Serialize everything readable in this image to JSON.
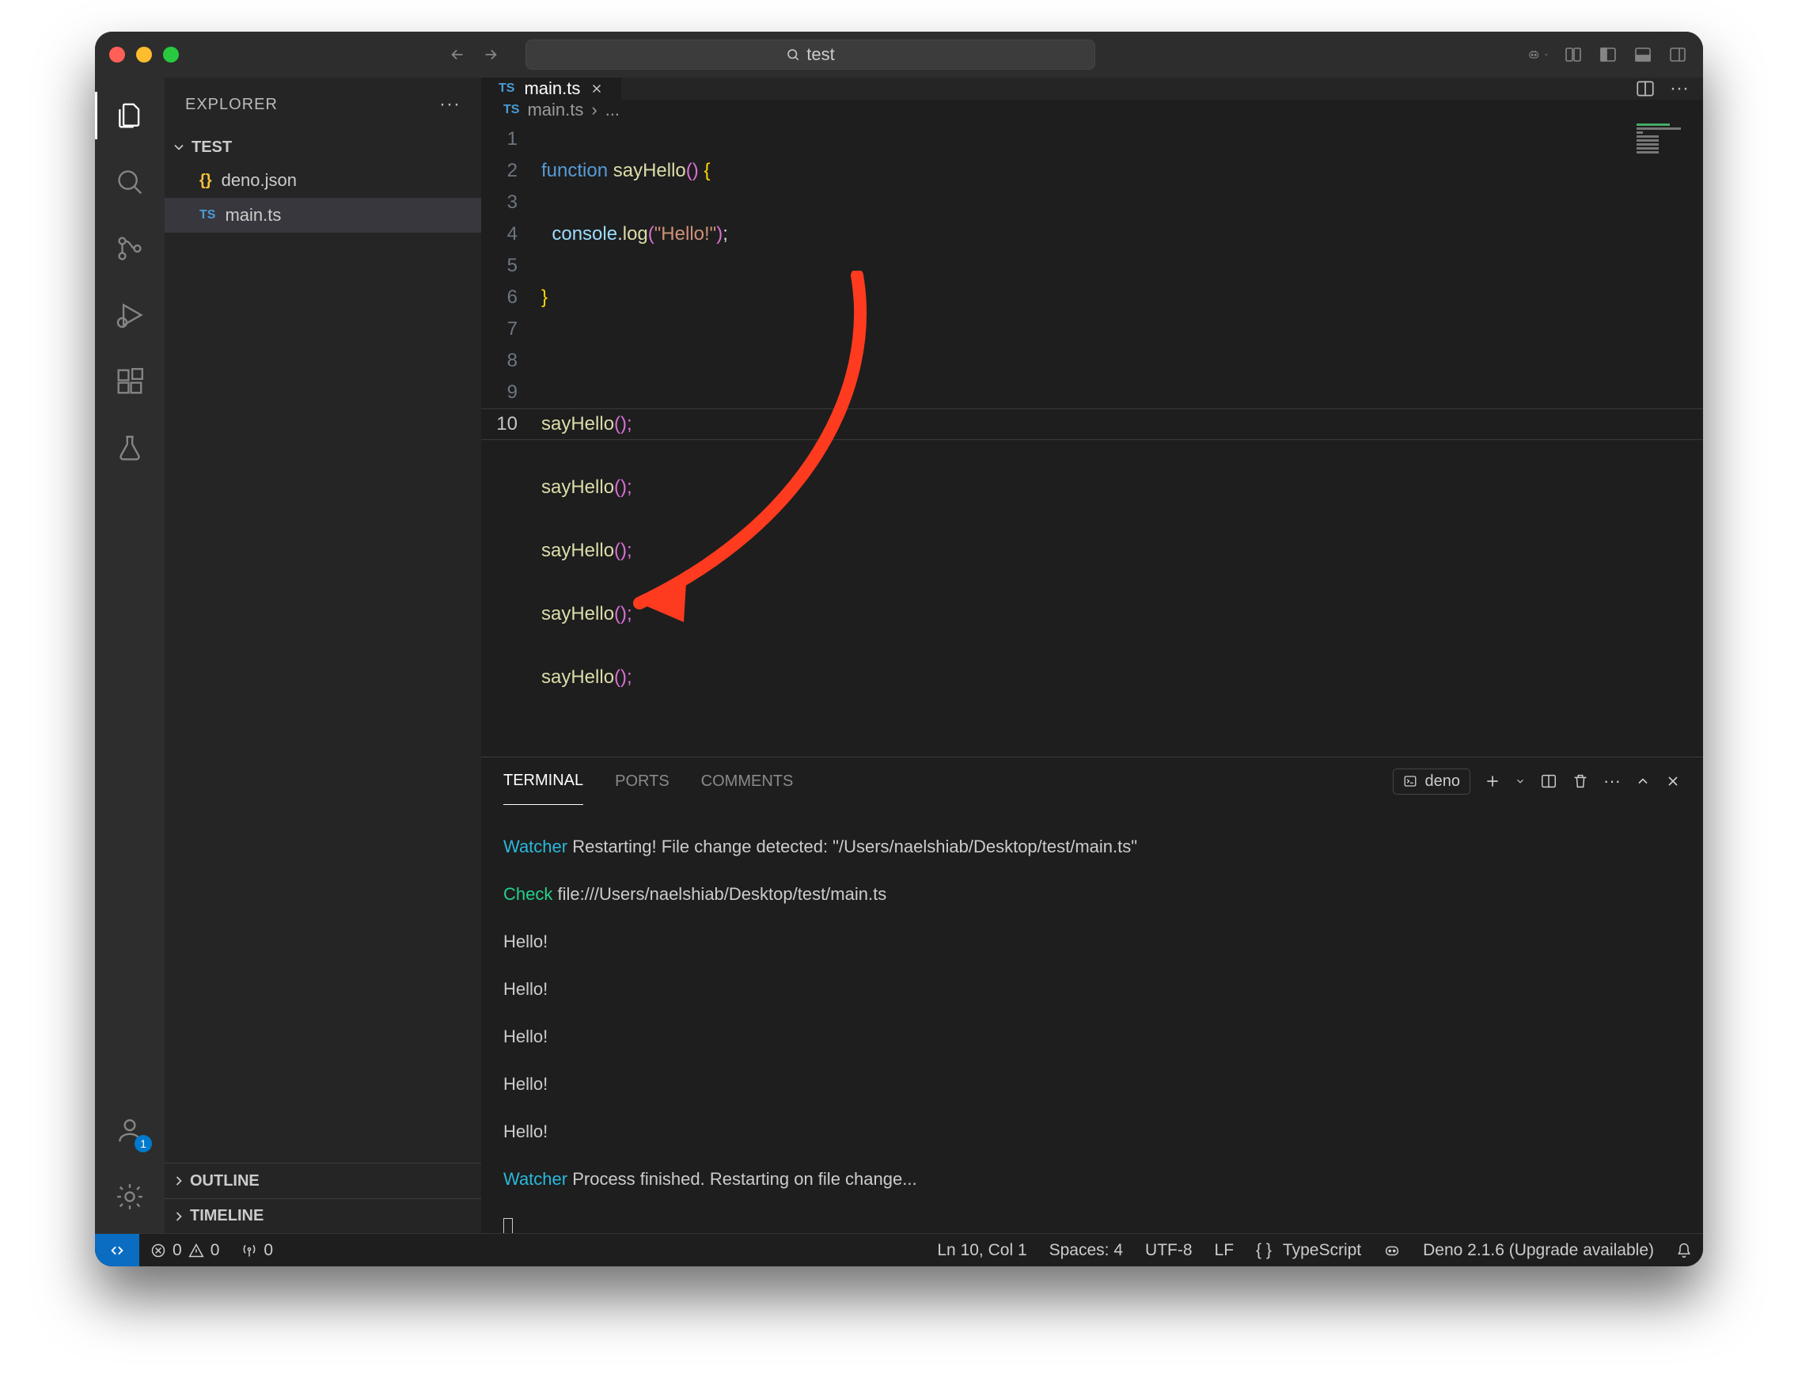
{
  "title": {
    "search": "test"
  },
  "sidebar": {
    "title": "EXPLORER",
    "folder": "TEST",
    "files": [
      {
        "icon": "{}",
        "name": "deno.json"
      },
      {
        "icon": "TS",
        "name": "main.ts"
      }
    ],
    "sections": {
      "outline": "OUTLINE",
      "timeline": "TIMELINE"
    }
  },
  "tabs": {
    "active": {
      "icon": "TS",
      "label": "main.ts"
    }
  },
  "breadcrumb": {
    "icon": "TS",
    "file": "main.ts",
    "sep": "›",
    "rest": "..."
  },
  "editor": {
    "line_numbers": [
      "1",
      "2",
      "3",
      "4",
      "5",
      "6",
      "7",
      "8",
      "9",
      "10"
    ],
    "code": {
      "l1a": "function ",
      "l1b": "sayHello",
      "l1c": "() ",
      "l1d": "{",
      "l2a": "  ",
      "l2b": "console",
      "l2c": ".",
      "l2d": "log",
      "l2e": "(",
      "l2f": "\"Hello!\"",
      "l2g": ")",
      "l2h": ";",
      "l3": "}",
      "l4": "",
      "call": "sayHello",
      "callp": "();"
    }
  },
  "panel": {
    "tabs": {
      "terminal": "TERMINAL",
      "ports": "PORTS",
      "comments": "COMMENTS"
    },
    "profile": "deno",
    "lines": {
      "w1a": "Watcher",
      "w1b": " Restarting! File change detected: \"/Users/naelshiab/Desktop/test/main.ts\"",
      "c1a": "Check",
      "c1b": " file:///Users/naelshiab/Desktop/test/main.ts",
      "h": "Hello!",
      "w2a": "Watcher",
      "w2b": " Process finished. Restarting on file change..."
    }
  },
  "status": {
    "errors": "0",
    "warnings": "0",
    "ports": "0",
    "ln": "Ln 10, Col 1",
    "spaces": "Spaces: 4",
    "enc": "UTF-8",
    "eol": "LF",
    "lang": "TypeScript",
    "deno": "Deno 2.1.6 (Upgrade available)"
  },
  "accounts_badge": "1"
}
